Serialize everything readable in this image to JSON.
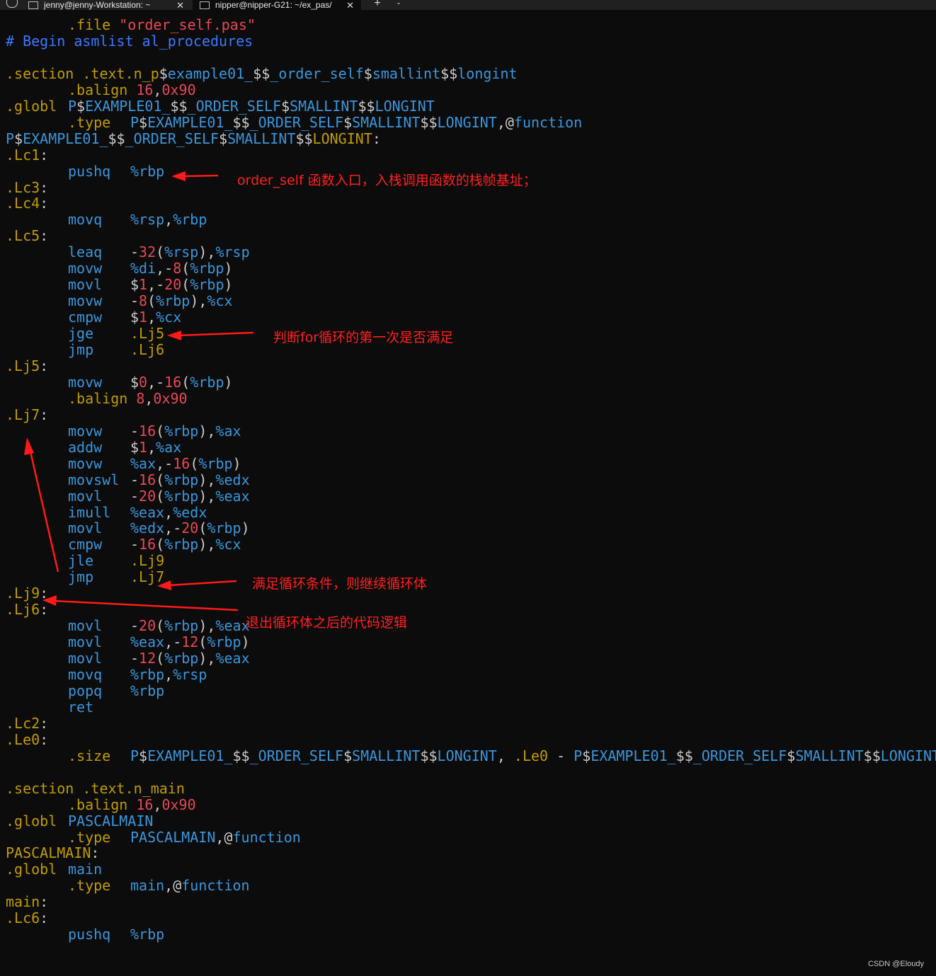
{
  "tabs": [
    {
      "title": "jenny@jenny-Workstation: ~",
      "close": "✕"
    },
    {
      "title": "nipper@nipper-G21: ~/ex_pas/",
      "close": "✕"
    }
  ],
  "new_tab_label": "+",
  "dropdown_label": "⌄",
  "lines": [
    {
      "c2": [
        {
          "t": ".file ",
          "k": "dir"
        },
        {
          "t": "\"order_self.pas\"",
          "k": "str"
        }
      ]
    },
    {
      "c1": [
        {
          "t": "# Begin asmlist al_procedures",
          "k": "cmt"
        }
      ]
    },
    {},
    {
      "c1": [
        {
          "t": ".section .text.n_p",
          "k": "dir"
        },
        {
          "t": "$",
          "k": "wht"
        },
        {
          "t": "example01_",
          "k": "reg"
        },
        {
          "t": "$$",
          "k": "wht"
        },
        {
          "t": "_order_self",
          "k": "reg"
        },
        {
          "t": "$",
          "k": "wht"
        },
        {
          "t": "smallint",
          "k": "reg"
        },
        {
          "t": "$$",
          "k": "wht"
        },
        {
          "t": "longint",
          "k": "reg"
        }
      ]
    },
    {
      "c2": [
        {
          "t": ".balign ",
          "k": "dir"
        },
        {
          "t": "16",
          "k": "num"
        },
        {
          "t": ",",
          "k": "wht"
        },
        {
          "t": "0x90",
          "k": "num"
        }
      ]
    },
    {
      "c1": [
        {
          "t": ".globl",
          "k": "dir"
        }
      ],
      "c2": [
        {
          "t": "P",
          "k": "reg"
        },
        {
          "t": "$",
          "k": "wht"
        },
        {
          "t": "EXAMPLE01_",
          "k": "reg"
        },
        {
          "t": "$$",
          "k": "wht"
        },
        {
          "t": "_ORDER_SELF",
          "k": "reg"
        },
        {
          "t": "$",
          "k": "wht"
        },
        {
          "t": "SMALLINT",
          "k": "reg"
        },
        {
          "t": "$$",
          "k": "wht"
        },
        {
          "t": "LONGINT",
          "k": "reg"
        }
      ]
    },
    {
      "c2": [
        {
          "t": ".type",
          "k": "dir"
        }
      ],
      "c3": [
        {
          "t": "P",
          "k": "reg"
        },
        {
          "t": "$",
          "k": "wht"
        },
        {
          "t": "EXAMPLE01_",
          "k": "reg"
        },
        {
          "t": "$$",
          "k": "wht"
        },
        {
          "t": "_ORDER_SELF",
          "k": "reg"
        },
        {
          "t": "$",
          "k": "wht"
        },
        {
          "t": "SMALLINT",
          "k": "reg"
        },
        {
          "t": "$$",
          "k": "wht"
        },
        {
          "t": "LONGINT",
          "k": "reg"
        },
        {
          "t": ",@",
          "k": "wht"
        },
        {
          "t": "function",
          "k": "reg"
        }
      ]
    },
    {
      "c1": [
        {
          "t": "P",
          "k": "reg"
        },
        {
          "t": "$",
          "k": "wht"
        },
        {
          "t": "EXAMPLE01_",
          "k": "reg"
        },
        {
          "t": "$$",
          "k": "wht"
        },
        {
          "t": "_ORDER_SELF",
          "k": "reg"
        },
        {
          "t": "$",
          "k": "wht"
        },
        {
          "t": "SMALLINT",
          "k": "reg"
        },
        {
          "t": "$$",
          "k": "wht"
        },
        {
          "t": "LONGINT",
          "k": "dir"
        },
        {
          "t": ":",
          "k": "wht"
        }
      ]
    },
    {
      "c1": [
        {
          "t": ".Lc1",
          "k": "dir"
        },
        {
          "t": ":",
          "k": "wht"
        }
      ]
    },
    {
      "c2": [
        {
          "t": "pushq",
          "k": "reg"
        }
      ],
      "c3": [
        {
          "t": "%rbp",
          "k": "reg"
        }
      ]
    },
    {
      "c1": [
        {
          "t": ".Lc3",
          "k": "dir"
        },
        {
          "t": ":",
          "k": "wht"
        }
      ]
    },
    {
      "c1": [
        {
          "t": ".Lc4",
          "k": "dir"
        },
        {
          "t": ":",
          "k": "wht"
        }
      ]
    },
    {
      "c2": [
        {
          "t": "movq",
          "k": "reg"
        }
      ],
      "c3": [
        {
          "t": "%rsp",
          "k": "reg"
        },
        {
          "t": ",",
          "k": "wht"
        },
        {
          "t": "%rbp",
          "k": "reg"
        }
      ]
    },
    {
      "c1": [
        {
          "t": ".Lc5",
          "k": "dir"
        },
        {
          "t": ":",
          "k": "wht"
        }
      ]
    },
    {
      "c2": [
        {
          "t": "leaq",
          "k": "reg"
        }
      ],
      "c3": [
        {
          "t": "-",
          "k": "wht"
        },
        {
          "t": "32",
          "k": "num"
        },
        {
          "t": "(",
          "k": "wht"
        },
        {
          "t": "%rsp",
          "k": "reg"
        },
        {
          "t": "),",
          "k": "wht"
        },
        {
          "t": "%rsp",
          "k": "reg"
        }
      ]
    },
    {
      "c2": [
        {
          "t": "movw",
          "k": "reg"
        }
      ],
      "c3": [
        {
          "t": "%di",
          "k": "reg"
        },
        {
          "t": ",-",
          "k": "wht"
        },
        {
          "t": "8",
          "k": "num"
        },
        {
          "t": "(",
          "k": "wht"
        },
        {
          "t": "%rbp",
          "k": "reg"
        },
        {
          "t": ")",
          "k": "wht"
        }
      ]
    },
    {
      "c2": [
        {
          "t": "movl",
          "k": "reg"
        }
      ],
      "c3": [
        {
          "t": "$",
          "k": "wht"
        },
        {
          "t": "1",
          "k": "num"
        },
        {
          "t": ",-",
          "k": "wht"
        },
        {
          "t": "20",
          "k": "num"
        },
        {
          "t": "(",
          "k": "wht"
        },
        {
          "t": "%rbp",
          "k": "reg"
        },
        {
          "t": ")",
          "k": "wht"
        }
      ]
    },
    {
      "c2": [
        {
          "t": "movw",
          "k": "reg"
        }
      ],
      "c3": [
        {
          "t": "-",
          "k": "wht"
        },
        {
          "t": "8",
          "k": "num"
        },
        {
          "t": "(",
          "k": "wht"
        },
        {
          "t": "%rbp",
          "k": "reg"
        },
        {
          "t": "),",
          "k": "wht"
        },
        {
          "t": "%cx",
          "k": "reg"
        }
      ]
    },
    {
      "c2": [
        {
          "t": "cmpw",
          "k": "reg"
        }
      ],
      "c3": [
        {
          "t": "$",
          "k": "wht"
        },
        {
          "t": "1",
          "k": "num"
        },
        {
          "t": ",",
          "k": "wht"
        },
        {
          "t": "%cx",
          "k": "reg"
        }
      ]
    },
    {
      "c2": [
        {
          "t": "jge",
          "k": "reg"
        }
      ],
      "c3": [
        {
          "t": ".Lj5",
          "k": "dir"
        }
      ]
    },
    {
      "c2": [
        {
          "t": "jmp",
          "k": "reg"
        }
      ],
      "c3": [
        {
          "t": ".Lj6",
          "k": "dir"
        }
      ]
    },
    {
      "c1": [
        {
          "t": ".Lj5",
          "k": "dir"
        },
        {
          "t": ":",
          "k": "wht"
        }
      ]
    },
    {
      "c2": [
        {
          "t": "movw",
          "k": "reg"
        }
      ],
      "c3": [
        {
          "t": "$",
          "k": "wht"
        },
        {
          "t": "0",
          "k": "num"
        },
        {
          "t": ",-",
          "k": "wht"
        },
        {
          "t": "16",
          "k": "num"
        },
        {
          "t": "(",
          "k": "wht"
        },
        {
          "t": "%rbp",
          "k": "reg"
        },
        {
          "t": ")",
          "k": "wht"
        }
      ]
    },
    {
      "c2": [
        {
          "t": ".balign ",
          "k": "dir"
        },
        {
          "t": "8",
          "k": "num"
        },
        {
          "t": ",",
          "k": "wht"
        },
        {
          "t": "0x90",
          "k": "num"
        }
      ]
    },
    {
      "c1": [
        {
          "t": ".Lj7",
          "k": "dir"
        },
        {
          "t": ":",
          "k": "wht"
        }
      ]
    },
    {
      "c2": [
        {
          "t": "movw",
          "k": "reg"
        }
      ],
      "c3": [
        {
          "t": "-",
          "k": "wht"
        },
        {
          "t": "16",
          "k": "num"
        },
        {
          "t": "(",
          "k": "wht"
        },
        {
          "t": "%rbp",
          "k": "reg"
        },
        {
          "t": "),",
          "k": "wht"
        },
        {
          "t": "%ax",
          "k": "reg"
        }
      ]
    },
    {
      "c2": [
        {
          "t": "addw",
          "k": "reg"
        }
      ],
      "c3": [
        {
          "t": "$",
          "k": "wht"
        },
        {
          "t": "1",
          "k": "num"
        },
        {
          "t": ",",
          "k": "wht"
        },
        {
          "t": "%ax",
          "k": "reg"
        }
      ]
    },
    {
      "c2": [
        {
          "t": "movw",
          "k": "reg"
        }
      ],
      "c3": [
        {
          "t": "%ax",
          "k": "reg"
        },
        {
          "t": ",-",
          "k": "wht"
        },
        {
          "t": "16",
          "k": "num"
        },
        {
          "t": "(",
          "k": "wht"
        },
        {
          "t": "%rbp",
          "k": "reg"
        },
        {
          "t": ")",
          "k": "wht"
        }
      ]
    },
    {
      "c2": [
        {
          "t": "movswl",
          "k": "reg"
        }
      ],
      "c3": [
        {
          "t": "-",
          "k": "wht"
        },
        {
          "t": "16",
          "k": "num"
        },
        {
          "t": "(",
          "k": "wht"
        },
        {
          "t": "%rbp",
          "k": "reg"
        },
        {
          "t": "),",
          "k": "wht"
        },
        {
          "t": "%edx",
          "k": "reg"
        }
      ]
    },
    {
      "c2": [
        {
          "t": "movl",
          "k": "reg"
        }
      ],
      "c3": [
        {
          "t": "-",
          "k": "wht"
        },
        {
          "t": "20",
          "k": "num"
        },
        {
          "t": "(",
          "k": "wht"
        },
        {
          "t": "%rbp",
          "k": "reg"
        },
        {
          "t": "),",
          "k": "wht"
        },
        {
          "t": "%eax",
          "k": "reg"
        }
      ]
    },
    {
      "c2": [
        {
          "t": "imull",
          "k": "reg"
        }
      ],
      "c3": [
        {
          "t": "%eax",
          "k": "reg"
        },
        {
          "t": ",",
          "k": "wht"
        },
        {
          "t": "%edx",
          "k": "reg"
        }
      ]
    },
    {
      "c2": [
        {
          "t": "movl",
          "k": "reg"
        }
      ],
      "c3": [
        {
          "t": "%edx",
          "k": "reg"
        },
        {
          "t": ",-",
          "k": "wht"
        },
        {
          "t": "20",
          "k": "num"
        },
        {
          "t": "(",
          "k": "wht"
        },
        {
          "t": "%rbp",
          "k": "reg"
        },
        {
          "t": ")",
          "k": "wht"
        }
      ]
    },
    {
      "c2": [
        {
          "t": "cmpw",
          "k": "reg"
        }
      ],
      "c3": [
        {
          "t": "-",
          "k": "wht"
        },
        {
          "t": "16",
          "k": "num"
        },
        {
          "t": "(",
          "k": "wht"
        },
        {
          "t": "%rbp",
          "k": "reg"
        },
        {
          "t": "),",
          "k": "wht"
        },
        {
          "t": "%cx",
          "k": "reg"
        }
      ]
    },
    {
      "c2": [
        {
          "t": "jle",
          "k": "reg"
        }
      ],
      "c3": [
        {
          "t": ".Lj9",
          "k": "dir"
        }
      ]
    },
    {
      "c2": [
        {
          "t": "jmp",
          "k": "reg"
        }
      ],
      "c3": [
        {
          "t": ".Lj7",
          "k": "dir"
        }
      ]
    },
    {
      "c1": [
        {
          "t": ".Lj9",
          "k": "dir"
        },
        {
          "t": ":",
          "k": "wht"
        }
      ]
    },
    {
      "c1": [
        {
          "t": ".Lj6",
          "k": "dir"
        },
        {
          "t": ":",
          "k": "wht"
        }
      ]
    },
    {
      "c2": [
        {
          "t": "movl",
          "k": "reg"
        }
      ],
      "c3": [
        {
          "t": "-",
          "k": "wht"
        },
        {
          "t": "20",
          "k": "num"
        },
        {
          "t": "(",
          "k": "wht"
        },
        {
          "t": "%rbp",
          "k": "reg"
        },
        {
          "t": "),",
          "k": "wht"
        },
        {
          "t": "%eax",
          "k": "reg"
        }
      ]
    },
    {
      "c2": [
        {
          "t": "movl",
          "k": "reg"
        }
      ],
      "c3": [
        {
          "t": "%eax",
          "k": "reg"
        },
        {
          "t": ",-",
          "k": "wht"
        },
        {
          "t": "12",
          "k": "num"
        },
        {
          "t": "(",
          "k": "wht"
        },
        {
          "t": "%rbp",
          "k": "reg"
        },
        {
          "t": ")",
          "k": "wht"
        }
      ]
    },
    {
      "c2": [
        {
          "t": "movl",
          "k": "reg"
        }
      ],
      "c3": [
        {
          "t": "-",
          "k": "wht"
        },
        {
          "t": "12",
          "k": "num"
        },
        {
          "t": "(",
          "k": "wht"
        },
        {
          "t": "%rbp",
          "k": "reg"
        },
        {
          "t": "),",
          "k": "wht"
        },
        {
          "t": "%eax",
          "k": "reg"
        }
      ]
    },
    {
      "c2": [
        {
          "t": "movq",
          "k": "reg"
        }
      ],
      "c3": [
        {
          "t": "%rbp",
          "k": "reg"
        },
        {
          "t": ",",
          "k": "wht"
        },
        {
          "t": "%rsp",
          "k": "reg"
        }
      ]
    },
    {
      "c2": [
        {
          "t": "popq",
          "k": "reg"
        }
      ],
      "c3": [
        {
          "t": "%rbp",
          "k": "reg"
        }
      ]
    },
    {
      "c2": [
        {
          "t": "ret",
          "k": "reg"
        }
      ]
    },
    {
      "c1": [
        {
          "t": ".Lc2",
          "k": "dir"
        },
        {
          "t": ":",
          "k": "wht"
        }
      ]
    },
    {
      "c1": [
        {
          "t": ".Le0",
          "k": "dir"
        },
        {
          "t": ":",
          "k": "wht"
        }
      ]
    },
    {
      "c2": [
        {
          "t": ".size",
          "k": "dir"
        }
      ],
      "c3": [
        {
          "t": "P",
          "k": "reg"
        },
        {
          "t": "$",
          "k": "wht"
        },
        {
          "t": "EXAMPLE01_",
          "k": "reg"
        },
        {
          "t": "$$",
          "k": "wht"
        },
        {
          "t": "_ORDER_SELF",
          "k": "reg"
        },
        {
          "t": "$",
          "k": "wht"
        },
        {
          "t": "SMALLINT",
          "k": "reg"
        },
        {
          "t": "$$",
          "k": "wht"
        },
        {
          "t": "LONGINT",
          "k": "reg"
        },
        {
          "t": ", ",
          "k": "wht"
        },
        {
          "t": ".Le0",
          "k": "dir"
        },
        {
          "t": " - ",
          "k": "wht"
        },
        {
          "t": "P",
          "k": "reg"
        },
        {
          "t": "$",
          "k": "wht"
        },
        {
          "t": "EXAMPLE01_",
          "k": "reg"
        },
        {
          "t": "$$",
          "k": "wht"
        },
        {
          "t": "_ORDER_SELF",
          "k": "reg"
        },
        {
          "t": "$",
          "k": "wht"
        },
        {
          "t": "SMALLINT",
          "k": "reg"
        },
        {
          "t": "$$",
          "k": "wht"
        },
        {
          "t": "LONGINT",
          "k": "reg"
        }
      ]
    },
    {},
    {
      "c1": [
        {
          "t": ".section .text.n_main",
          "k": "dir"
        }
      ]
    },
    {
      "c2": [
        {
          "t": ".balign ",
          "k": "dir"
        },
        {
          "t": "16",
          "k": "num"
        },
        {
          "t": ",",
          "k": "wht"
        },
        {
          "t": "0x90",
          "k": "num"
        }
      ]
    },
    {
      "c1": [
        {
          "t": ".globl",
          "k": "dir"
        }
      ],
      "c2": [
        {
          "t": "PASCALMAIN",
          "k": "reg"
        }
      ]
    },
    {
      "c2": [
        {
          "t": ".type",
          "k": "dir"
        }
      ],
      "c3": [
        {
          "t": "PASCALMAIN",
          "k": "reg"
        },
        {
          "t": ",@",
          "k": "wht"
        },
        {
          "t": "function",
          "k": "reg"
        }
      ]
    },
    {
      "c1": [
        {
          "t": "PASCALMAIN",
          "k": "dir"
        },
        {
          "t": ":",
          "k": "wht"
        }
      ]
    },
    {
      "c1": [
        {
          "t": ".globl",
          "k": "dir"
        }
      ],
      "c2": [
        {
          "t": "main",
          "k": "reg"
        }
      ]
    },
    {
      "c2": [
        {
          "t": ".type",
          "k": "dir"
        }
      ],
      "c3": [
        {
          "t": "main",
          "k": "reg"
        },
        {
          "t": ",@",
          "k": "wht"
        },
        {
          "t": "function",
          "k": "reg"
        }
      ]
    },
    {
      "c1": [
        {
          "t": "main",
          "k": "dir"
        },
        {
          "t": ":",
          "k": "wht"
        }
      ]
    },
    {
      "c1": [
        {
          "t": ".Lc6",
          "k": "dir"
        },
        {
          "t": ":",
          "k": "wht"
        }
      ]
    },
    {
      "c2": [
        {
          "t": "pushq",
          "k": "reg"
        }
      ],
      "c3": [
        {
          "t": "%rbp",
          "k": "reg"
        }
      ]
    }
  ],
  "annotations": {
    "entry": "order_self 函数入口，入栈调用函数的栈帧基址；",
    "first_check": "判断for循环的第一次是否满足",
    "continue_loop": "满足循环条件，则继续循环体",
    "exit_loop": "退出循环体之后的代码逻辑"
  },
  "watermark": "CSDN @Eloudy",
  "colors": {
    "background": "#0c0c0c",
    "blue": "#3a96dd",
    "yellow": "#c19c00",
    "red": "#e74856",
    "white": "#cccccc",
    "comment": "#3b78ff",
    "annotation": "#ff2020"
  }
}
